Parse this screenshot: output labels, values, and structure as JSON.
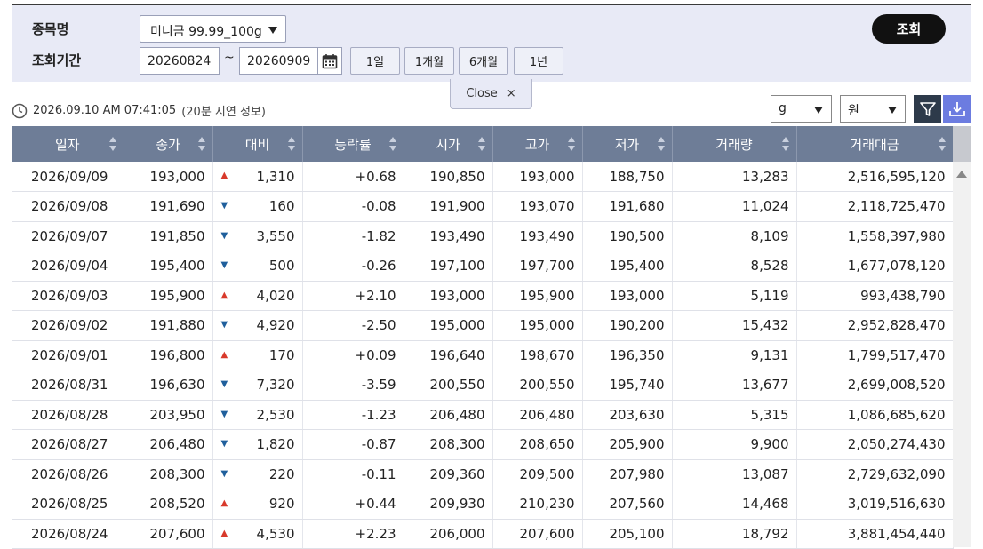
{
  "search": {
    "item_label": "종목명",
    "item_value": "미니금 99.99_100g",
    "period_label": "조회기간",
    "date_from": "20260824",
    "date_to": "20260909",
    "tilde": "~",
    "period_buttons": [
      "1일",
      "1개월",
      "6개월",
      "1년"
    ],
    "search_button": "조회"
  },
  "close_tab": {
    "label": "Close",
    "icon": "×"
  },
  "info": {
    "timestamp": "2026.09.10 AM 07:41:05",
    "delay_note": "(20분 지연 정보)"
  },
  "units": {
    "weight": "g",
    "currency": "원"
  },
  "colors": {
    "header": "#6e7d97",
    "up": "#e05a3a",
    "down": "#2f7fc1",
    "search_btn": "#111111"
  },
  "table": {
    "columns": [
      "일자",
      "종가",
      "대비",
      "등락률",
      "시가",
      "고가",
      "저가",
      "거래량",
      "거래대금"
    ],
    "rows": [
      {
        "date": "2026/09/09",
        "close": "193,000",
        "dir": "up",
        "diff": "1,310",
        "rate": "+0.68",
        "open": "190,850",
        "high": "193,000",
        "low": "188,750",
        "volume": "13,283",
        "amount": "2,516,595,120"
      },
      {
        "date": "2026/09/08",
        "close": "191,690",
        "dir": "down",
        "diff": "160",
        "rate": "-0.08",
        "open": "191,900",
        "high": "193,070",
        "low": "191,680",
        "volume": "11,024",
        "amount": "2,118,725,470"
      },
      {
        "date": "2026/09/07",
        "close": "191,850",
        "dir": "down",
        "diff": "3,550",
        "rate": "-1.82",
        "open": "193,490",
        "high": "193,490",
        "low": "190,500",
        "volume": "8,109",
        "amount": "1,558,397,980"
      },
      {
        "date": "2026/09/04",
        "close": "195,400",
        "dir": "down",
        "diff": "500",
        "rate": "-0.26",
        "open": "197,100",
        "high": "197,700",
        "low": "195,400",
        "volume": "8,528",
        "amount": "1,677,078,120"
      },
      {
        "date": "2026/09/03",
        "close": "195,900",
        "dir": "up",
        "diff": "4,020",
        "rate": "+2.10",
        "open": "193,000",
        "high": "195,900",
        "low": "193,000",
        "volume": "5,119",
        "amount": "993,438,790"
      },
      {
        "date": "2026/09/02",
        "close": "191,880",
        "dir": "down",
        "diff": "4,920",
        "rate": "-2.50",
        "open": "195,000",
        "high": "195,000",
        "low": "190,200",
        "volume": "15,432",
        "amount": "2,952,828,470"
      },
      {
        "date": "2026/09/01",
        "close": "196,800",
        "dir": "up",
        "diff": "170",
        "rate": "+0.09",
        "open": "196,640",
        "high": "198,670",
        "low": "196,350",
        "volume": "9,131",
        "amount": "1,799,517,470"
      },
      {
        "date": "2026/08/31",
        "close": "196,630",
        "dir": "down",
        "diff": "7,320",
        "rate": "-3.59",
        "open": "200,550",
        "high": "200,550",
        "low": "195,740",
        "volume": "13,677",
        "amount": "2,699,008,520"
      },
      {
        "date": "2026/08/28",
        "close": "203,950",
        "dir": "down",
        "diff": "2,530",
        "rate": "-1.23",
        "open": "206,480",
        "high": "206,480",
        "low": "203,630",
        "volume": "5,315",
        "amount": "1,086,685,620"
      },
      {
        "date": "2026/08/27",
        "close": "206,480",
        "dir": "down",
        "diff": "1,820",
        "rate": "-0.87",
        "open": "208,300",
        "high": "208,650",
        "low": "205,900",
        "volume": "9,900",
        "amount": "2,050,274,430"
      },
      {
        "date": "2026/08/26",
        "close": "208,300",
        "dir": "down",
        "diff": "220",
        "rate": "-0.11",
        "open": "209,360",
        "high": "209,500",
        "low": "207,980",
        "volume": "13,087",
        "amount": "2,729,632,090"
      },
      {
        "date": "2026/08/25",
        "close": "208,520",
        "dir": "up",
        "diff": "920",
        "rate": "+0.44",
        "open": "209,930",
        "high": "210,230",
        "low": "207,560",
        "volume": "14,468",
        "amount": "3,019,516,630"
      },
      {
        "date": "2026/08/24",
        "close": "207,600",
        "dir": "up",
        "diff": "4,530",
        "rate": "+2.23",
        "open": "206,000",
        "high": "207,600",
        "low": "205,100",
        "volume": "18,792",
        "amount": "3,881,454,440"
      }
    ]
  }
}
